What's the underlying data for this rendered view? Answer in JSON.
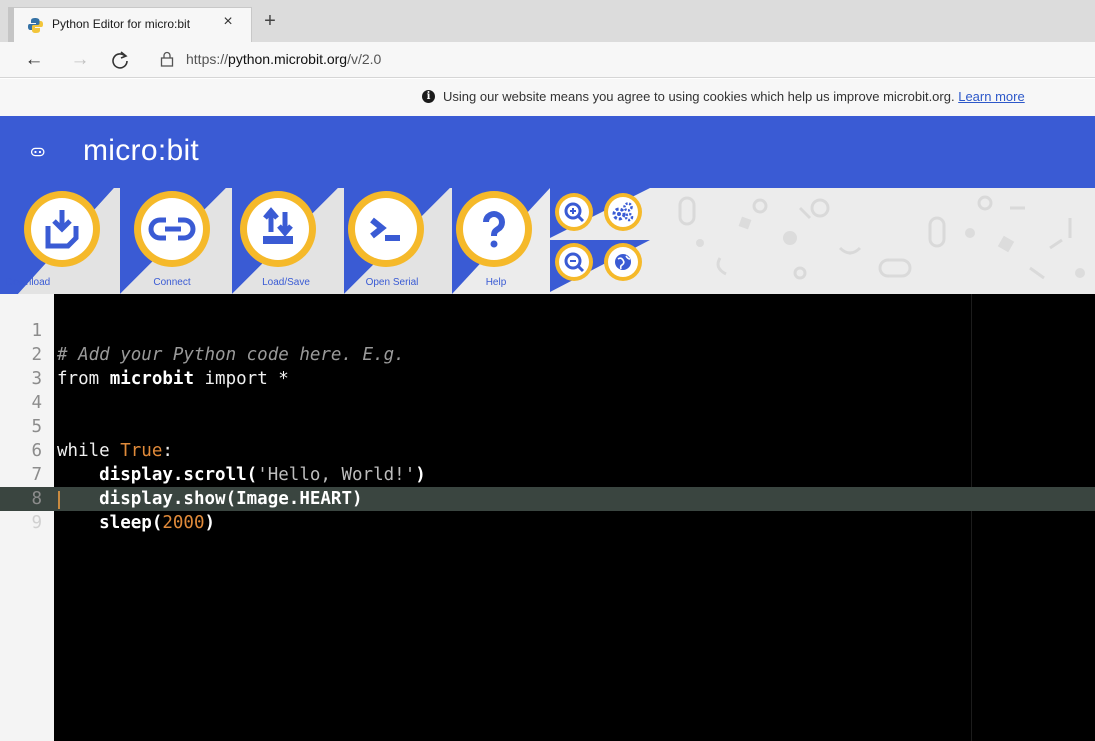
{
  "browser": {
    "tab_title": "Python Editor for micro:bit",
    "tab_close": "×",
    "new_tab": "+",
    "url_prefix": "https://",
    "url_host": "python.microbit.org",
    "url_path": "/v/2.0"
  },
  "cookie_notice": {
    "text": "Using our website means you agree to using cookies which help us improve microbit.org.",
    "link": "Learn more"
  },
  "header": {
    "logo_text": "micro:bit"
  },
  "toolbar": {
    "buttons": [
      {
        "label": "Download",
        "icon": "download-icon"
      },
      {
        "label": "Connect",
        "icon": "connect-icon"
      },
      {
        "label": "Load/Save",
        "icon": "load-save-icon"
      },
      {
        "label": "Open Serial",
        "icon": "serial-terminal-icon"
      },
      {
        "label": "Help",
        "icon": "help-icon"
      }
    ],
    "small_buttons": [
      "zoom-in-icon",
      "settings-icon",
      "zoom-out-icon",
      "globe-icon"
    ]
  },
  "editor": {
    "lines": [
      {
        "n": "1",
        "text": "# Add your Python code here. E.g."
      },
      {
        "n": "2",
        "text": "from microbit import *"
      },
      {
        "n": "3",
        "text": ""
      },
      {
        "n": "4",
        "text": ""
      },
      {
        "n": "5",
        "text": "while True:"
      },
      {
        "n": "6",
        "text": "    display.scroll('Hello, World!')"
      },
      {
        "n": "7",
        "text": "    display.show(Image.HEART)"
      },
      {
        "n": "8",
        "text": "    sleep(2000)"
      },
      {
        "n": "9",
        "text": ""
      }
    ],
    "tokens": {
      "l1": "# Add your Python code here. E.g.",
      "l2a": "from ",
      "l2b": "microbit",
      "l2c": " import *",
      "l5a": "while ",
      "l5b": "True",
      "l5c": ":",
      "l6a": "    display.scroll(",
      "l6b": "'Hello, World!'",
      "l6c": ")",
      "l7": "    display.show(Image.HEART)",
      "l8a": "    sleep(",
      "l8b": "2000",
      "l8c": ")"
    }
  },
  "colors": {
    "brand_blue": "#3a5bd4",
    "button_yellow": "#f5b92a",
    "editor_bg": "#000000"
  }
}
